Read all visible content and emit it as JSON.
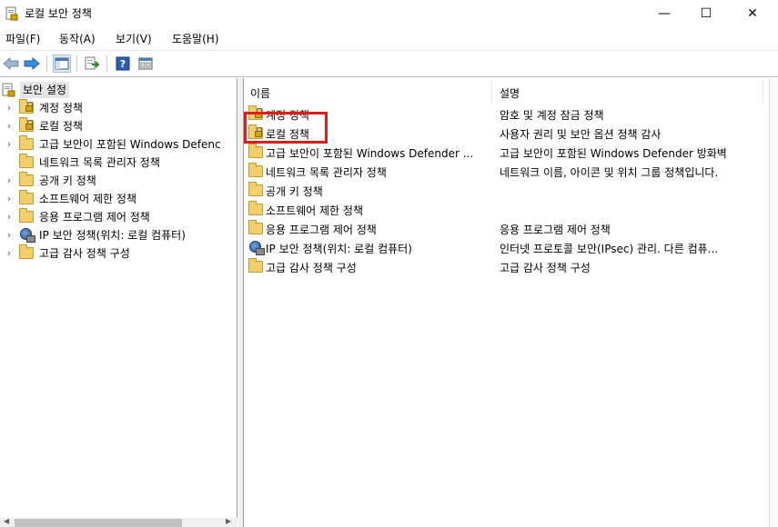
{
  "window": {
    "title": "로컬 보안 정책"
  },
  "menu": [
    "파일(F)",
    "동작(A)",
    "보기(V)",
    "도움말(H)"
  ],
  "window_controls": {
    "minimize": "—",
    "maximize": "☐",
    "close": "✕"
  },
  "toolbar": {
    "icons": [
      "back-arrow-icon",
      "forward-arrow-icon",
      "show-hide-tree-icon",
      "export-list-icon",
      "help-icon",
      "properties-icon"
    ]
  },
  "tree": {
    "root": "보안 설정",
    "items": [
      {
        "label": "계정 정책",
        "icon": "folder-lock"
      },
      {
        "label": "로컬 정책",
        "icon": "folder-lock"
      },
      {
        "label": "고급 보안이 포함된 Windows Defenc",
        "icon": "folder"
      },
      {
        "label": "네트워크 목록 관리자 정책",
        "icon": "folder"
      },
      {
        "label": "공개 키 정책",
        "icon": "folder"
      },
      {
        "label": "소프트웨어 제한 정책",
        "icon": "folder"
      },
      {
        "label": "응용 프로그램 제어 정책",
        "icon": "folder"
      },
      {
        "label": "IP 보안 정책(위치: 로컬 컴퓨터)",
        "icon": "ipsec"
      },
      {
        "label": "고급 감사 정책 구성",
        "icon": "folder"
      }
    ]
  },
  "list": {
    "columns": [
      "이름",
      "설명"
    ],
    "rows": [
      {
        "name": "계정 정책",
        "desc": "암호 및 계정 잠금 정책",
        "icon": "folder-lock"
      },
      {
        "name": "로컬 정책",
        "desc": "사용자 권리 및 보안 옵션 정책 감사",
        "icon": "folder-lock"
      },
      {
        "name": "고급 보안이 포함된 Windows Defender ...",
        "desc": "고급 보안이 포함된 Windows Defender 방화벽",
        "icon": "folder"
      },
      {
        "name": "네트워크 목록 관리자 정책",
        "desc": "네트워크 이름, 아이콘 및 위치 그룹 정책입니다.",
        "icon": "folder"
      },
      {
        "name": "공개 키 정책",
        "desc": "",
        "icon": "folder"
      },
      {
        "name": "소프트웨어 제한 정책",
        "desc": "",
        "icon": "folder"
      },
      {
        "name": "응용 프로그램 제어 정책",
        "desc": "응용 프로그램 제어 정책",
        "icon": "folder"
      },
      {
        "name": "IP 보안 정책(위치: 로컬 컴퓨터)",
        "desc": "인터넷 프로토콜 보안(IPsec) 관리. 다른 컴퓨...",
        "icon": "ipsec"
      },
      {
        "name": "고급 감사 정책 구성",
        "desc": "고급 감사 정책 구성",
        "icon": "folder"
      }
    ]
  },
  "colors": {
    "highlight": "#e41b1b",
    "selection": "#e5e5e5",
    "folder": "#f2cf6b"
  }
}
